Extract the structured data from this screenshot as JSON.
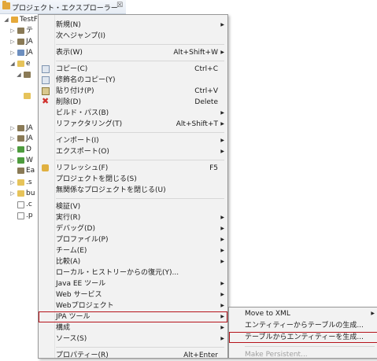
{
  "view": {
    "tab_title": "プロジェクト・エクスプローラー",
    "tab_close": "☒",
    "tree": [
      {
        "twisty": "◢",
        "label": "TestF",
        "icon": "project"
      },
      {
        "twisty": "▷",
        "label": "テ",
        "icon": "lib"
      },
      {
        "twisty": "▷",
        "label": "JA",
        "icon": "lib"
      },
      {
        "twisty": "▷",
        "label": "JA",
        "icon": "java"
      },
      {
        "twisty": "◢",
        "label": "e",
        "icon": "folder"
      },
      {
        "twisty": "◢",
        "label": "",
        "icon": "lib"
      },
      {
        "twisty": "",
        "label": "",
        "icon": "folder"
      },
      {
        "twisty": "▷",
        "label": "JA",
        "icon": "lib"
      },
      {
        "twisty": "▷",
        "label": "JA",
        "icon": "lib"
      },
      {
        "twisty": "▷",
        "label": "D",
        "icon": "green"
      },
      {
        "twisty": "▷",
        "label": "W",
        "icon": "green"
      },
      {
        "twisty": "",
        "label": "Ea",
        "icon": "lib"
      },
      {
        "twisty": "▷",
        "label": ".s",
        "icon": "folder"
      },
      {
        "twisty": "▷",
        "label": "bu",
        "icon": "folder"
      },
      {
        "twisty": "",
        "label": ".c",
        "icon": "file"
      },
      {
        "twisty": "",
        "label": ".p",
        "icon": "file"
      }
    ]
  },
  "context_menu": {
    "items": [
      {
        "label": "新規(N)",
        "shortcut": "",
        "submenu": true
      },
      {
        "label": "次へジャンプ(I)",
        "shortcut": "",
        "submenu": false
      },
      {
        "separator": true
      },
      {
        "label": "表示(W)",
        "shortcut": "Alt+Shift+W",
        "submenu": true
      },
      {
        "separator": true
      },
      {
        "label": "コピー(C)",
        "shortcut": "Ctrl+C",
        "submenu": false,
        "icon": "copy-icon"
      },
      {
        "label": "修飾名のコピー(Y)",
        "shortcut": "",
        "submenu": false,
        "icon": "copy-qualified-icon"
      },
      {
        "label": "貼り付け(P)",
        "shortcut": "Ctrl+V",
        "submenu": false,
        "icon": "paste-icon"
      },
      {
        "label": "削除(D)",
        "shortcut": "Delete",
        "submenu": false,
        "icon": "delete-icon"
      },
      {
        "label": "ビルド・パス(B)",
        "shortcut": "",
        "submenu": true
      },
      {
        "label": "リファクタリング(T)",
        "shortcut": "Alt+Shift+T",
        "submenu": true
      },
      {
        "separator": true
      },
      {
        "label": "インポート(I)",
        "shortcut": "",
        "submenu": true
      },
      {
        "label": "エクスポート(O)",
        "shortcut": "",
        "submenu": true
      },
      {
        "separator": true
      },
      {
        "label": "リフレッシュ(F)",
        "shortcut": "F5",
        "submenu": false,
        "icon": "refresh-icon"
      },
      {
        "label": "プロジェクトを閉じる(S)",
        "shortcut": "",
        "submenu": false
      },
      {
        "label": "無関係なプロジェクトを閉じる(U)",
        "shortcut": "",
        "submenu": false
      },
      {
        "separator": true
      },
      {
        "label": "検証(V)",
        "shortcut": "",
        "submenu": false
      },
      {
        "label": "実行(R)",
        "shortcut": "",
        "submenu": true
      },
      {
        "label": "デバッグ(D)",
        "shortcut": "",
        "submenu": true
      },
      {
        "label": "プロファイル(P)",
        "shortcut": "",
        "submenu": true
      },
      {
        "label": "チーム(E)",
        "shortcut": "",
        "submenu": true
      },
      {
        "label": "比較(A)",
        "shortcut": "",
        "submenu": true
      },
      {
        "label": "ローカル・ヒストリーからの復元(Y)...",
        "shortcut": "",
        "submenu": false
      },
      {
        "label": "Java EE ツール",
        "shortcut": "",
        "submenu": true
      },
      {
        "label": "Web サービス",
        "shortcut": "",
        "submenu": true
      },
      {
        "label": "Webプロジェクト",
        "shortcut": "",
        "submenu": true
      },
      {
        "label": "JPA ツール",
        "shortcut": "",
        "submenu": true,
        "highlighted": true
      },
      {
        "label": "構成",
        "shortcut": "",
        "submenu": true
      },
      {
        "label": "ソース(S)",
        "shortcut": "",
        "submenu": true
      },
      {
        "separator": true
      },
      {
        "label": "プロパティー(R)",
        "shortcut": "Alt+Enter",
        "submenu": false
      }
    ]
  },
  "jpa_submenu": {
    "items": [
      {
        "label": "Move to XML",
        "submenu": true,
        "disabled": false
      },
      {
        "label": "エンティティーからテーブルの生成...",
        "submenu": false,
        "disabled": false
      },
      {
        "label": "テーブルからエンティティーを生成...",
        "submenu": false,
        "disabled": false,
        "highlighted": true
      },
      {
        "separator": true
      },
      {
        "label": "Make Persistent...",
        "submenu": false,
        "disabled": true
      }
    ]
  },
  "colors": {
    "highlight_border": "#b5131a",
    "menu_bg": "#f2f2f2",
    "disabled_text": "#a0a0a0"
  }
}
